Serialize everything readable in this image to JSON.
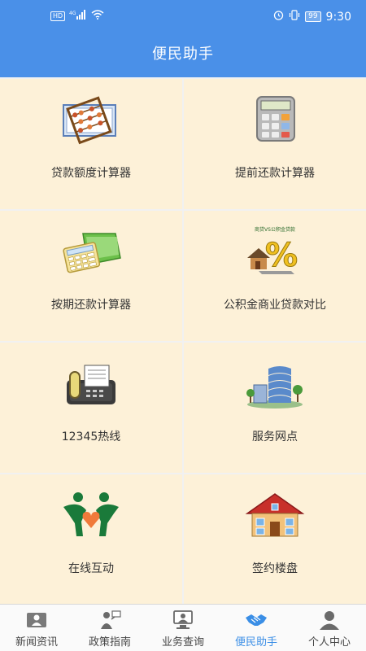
{
  "status_bar": {
    "network_badge": "HD",
    "signal_label": "4G",
    "battery": "99",
    "time": "9:30"
  },
  "header": {
    "title": "便民助手"
  },
  "tiles": [
    {
      "label": "贷款额度计算器",
      "icon": "abacus-icon"
    },
    {
      "label": "提前还款计算器",
      "icon": "calculator-icon"
    },
    {
      "label": "按期还款计算器",
      "icon": "calculator-folder-icon"
    },
    {
      "label": "公积金商业贷款对比",
      "icon": "percent-house-icon",
      "icon_text": "商贷VS公积金贷款"
    },
    {
      "label": "12345热线",
      "icon": "fax-phone-icon"
    },
    {
      "label": "服务网点",
      "icon": "building-icon"
    },
    {
      "label": "在线互动",
      "icon": "people-heart-icon"
    },
    {
      "label": "签约楼盘",
      "icon": "house-icon"
    }
  ],
  "tabbar": {
    "tabs": [
      {
        "label": "新闻资讯",
        "icon": "newspaper-icon",
        "active": false
      },
      {
        "label": "政策指南",
        "icon": "guide-person-icon",
        "active": false
      },
      {
        "label": "业务查询",
        "icon": "monitor-person-icon",
        "active": false
      },
      {
        "label": "便民助手",
        "icon": "handshake-icon",
        "active": true
      },
      {
        "label": "个人中心",
        "icon": "user-icon",
        "active": false
      }
    ]
  },
  "colors": {
    "header": "#4a90e8",
    "tile_bg": "#fdf1d8",
    "active_tab": "#3a8ee6"
  }
}
